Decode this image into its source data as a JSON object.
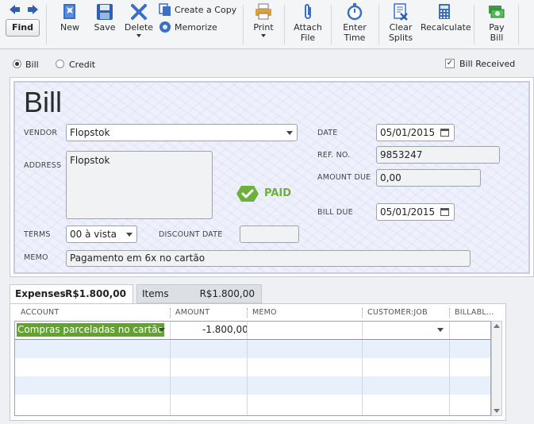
{
  "toolbar": {
    "find": "Find",
    "new": "New",
    "save": "Save",
    "delete": "Delete",
    "create_copy": "Create a Copy",
    "memorize": "Memorize",
    "print": "Print",
    "attach_file": [
      "Attach",
      "File"
    ],
    "enter_time": [
      "Enter",
      "Time"
    ],
    "clear_splits": [
      "Clear",
      "Splits"
    ],
    "recalculate": "Recalculate",
    "pay_bill": [
      "Pay",
      "Bill"
    ]
  },
  "mode": {
    "bill": "Bill",
    "credit": "Credit",
    "selected": "Bill",
    "bill_received": "Bill Received",
    "bill_received_checked": true
  },
  "form": {
    "title": "Bill",
    "vendor_label": "VENDOR",
    "vendor": "Flopstok",
    "address_label": "ADDRESS",
    "address": "Flopstok",
    "date_label": "DATE",
    "date": "05/01/2015",
    "ref_label": "REF. NO.",
    "ref": "9853247",
    "amount_due_label": "AMOUNT DUE",
    "amount_due": "0,00",
    "bill_due_label": "BILL DUE",
    "bill_due": "05/01/2015",
    "terms_label": "TERMS",
    "terms": "00 à vista",
    "discount_date_label": "DISCOUNT DATE",
    "discount_date": "",
    "memo_label": "MEMO",
    "memo": "Pagamento em 6x no cartão",
    "paid_stamp": "PAID"
  },
  "tabs": [
    {
      "label": "Expenses",
      "amount": "-R$1.800,00",
      "active": true
    },
    {
      "label": "Items",
      "amount": "R$1.800,00",
      "active": false
    }
  ],
  "grid": {
    "columns": [
      "ACCOUNT",
      "AMOUNT",
      "MEMO",
      "CUSTOMER:JOB",
      "BILLABL..."
    ],
    "rows": [
      {
        "account": "Compras parceladas no cartão",
        "amount": "-1.800,00",
        "memo": "",
        "customer_job": "",
        "billable": ""
      }
    ]
  },
  "colors": {
    "accent_green": "#62a32e",
    "paid_green": "#6fb03c",
    "toolbar_icon_blue": "#3a6fc4"
  }
}
